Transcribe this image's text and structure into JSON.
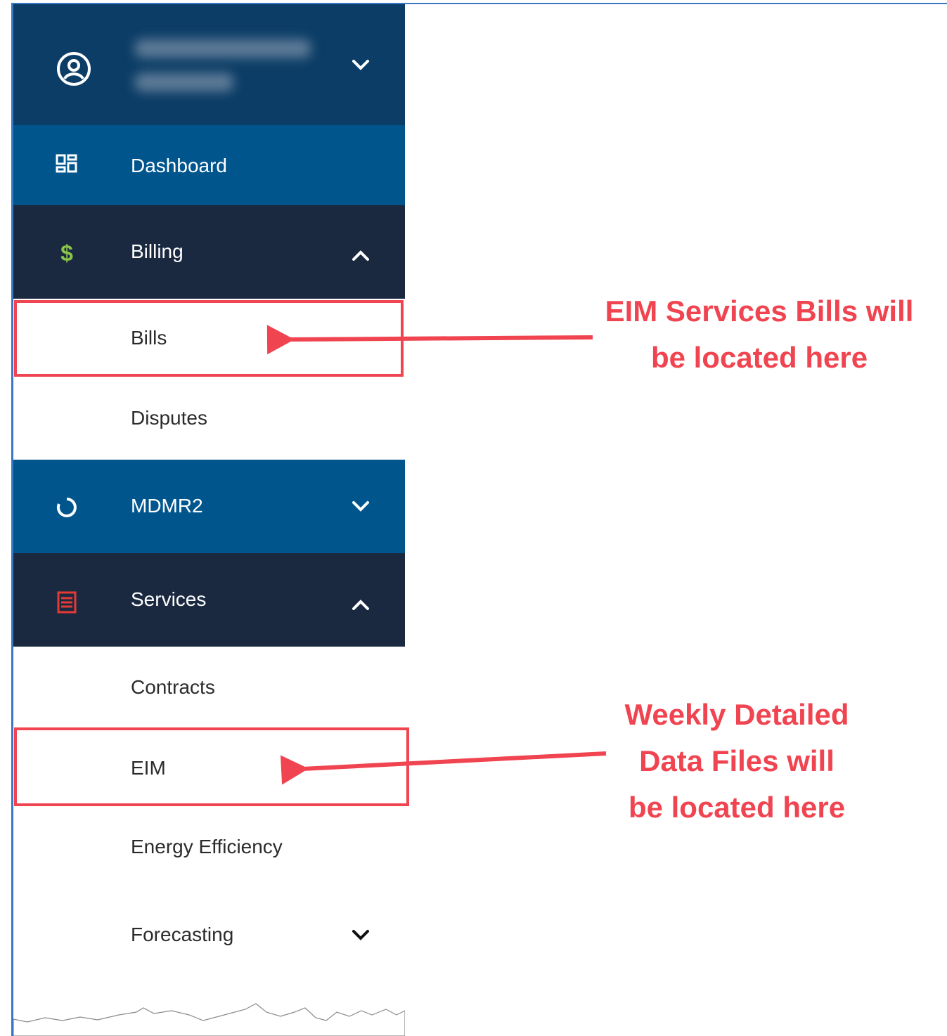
{
  "sidebar": {
    "nav": {
      "dashboard": "Dashboard",
      "billing": "Billing",
      "billing_items": [
        "Bills",
        "Disputes"
      ],
      "mdmr2": "MDMR2",
      "services": "Services",
      "services_items": [
        "Contracts",
        "EIM",
        "Energy Efficiency",
        "Forecasting"
      ]
    }
  },
  "annotations": {
    "bills": [
      "EIM Services Bills will",
      "be located here"
    ],
    "eim": [
      "Weekly Detailed",
      "Data Files will",
      "be located here"
    ]
  },
  "colors": {
    "account_bg": "#0c3d66",
    "active_bg": "#00558d",
    "section_bg": "#1a2940",
    "annotation_red": "#f04450",
    "billing_icon": "#8bc34a",
    "services_icon": "#e53935"
  },
  "icons": {
    "account": "user-circle-icon",
    "dashboard": "dashboard-grid-icon",
    "billing": "dollar-icon",
    "mdmr2": "circle-refresh-icon",
    "services": "document-list-icon"
  }
}
